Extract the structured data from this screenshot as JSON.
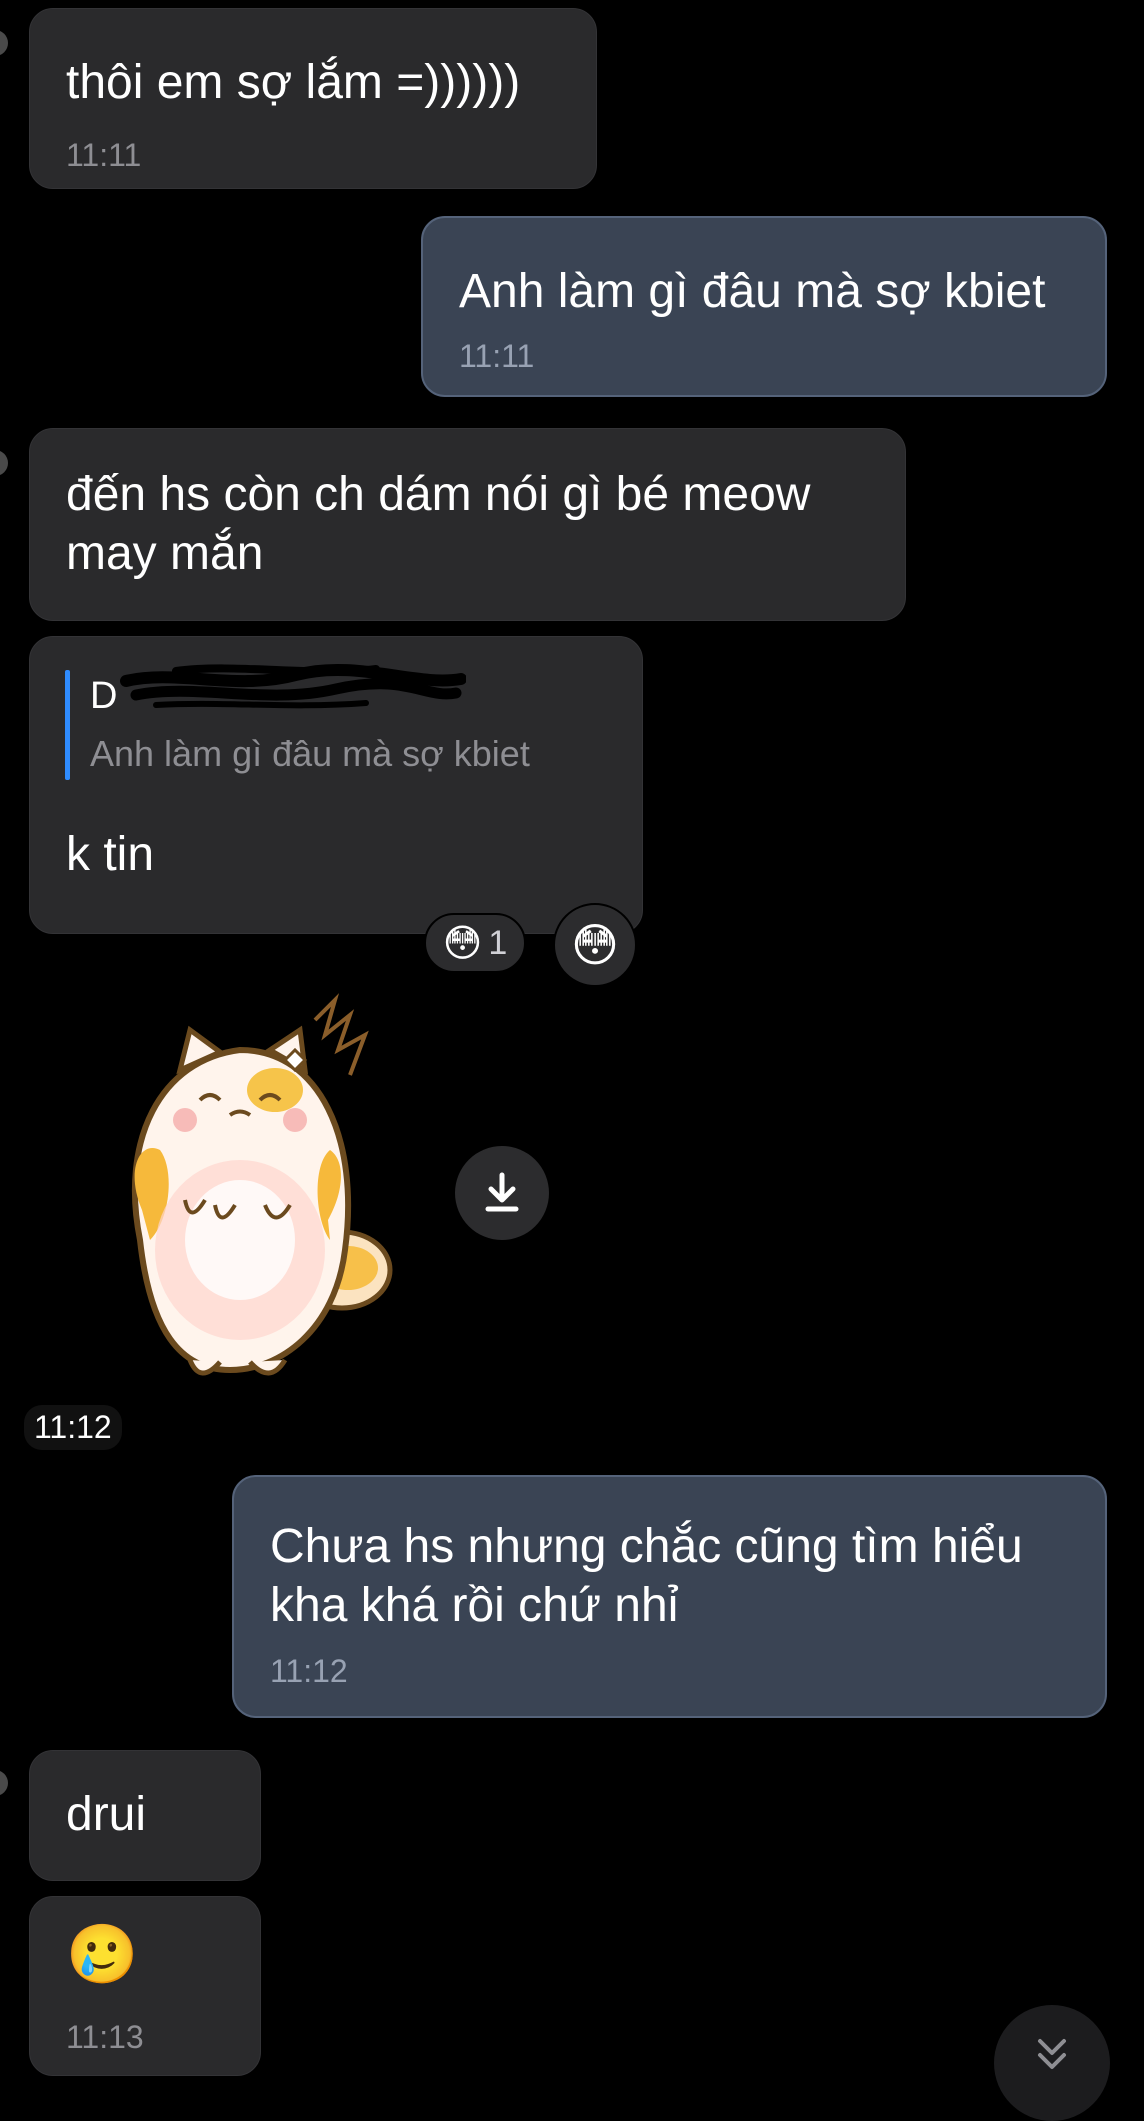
{
  "colors": {
    "background": "#000000",
    "incoming_bubble": "#2a2a2c",
    "outgoing_bubble": "#3a4454",
    "reply_accent": "#2f8cff",
    "timestamp": "#8e8e93"
  },
  "messages": [
    {
      "direction": "incoming",
      "text": "thôi em sợ lắm =))))))",
      "time": "11:11"
    },
    {
      "direction": "outgoing",
      "text": "Anh làm gì đâu mà sợ kbiet",
      "time": "11:11"
    },
    {
      "direction": "incoming",
      "lines": [
        "đến hs còn ch dám nói gì bé meow",
        "may mắn"
      ]
    },
    {
      "direction": "incoming",
      "reply": {
        "name": "D",
        "quote": "Anh làm gì đâu mà sợ kbiet"
      },
      "text": "k tin",
      "reactions": [
        {
          "emoji": "😳",
          "count": "1"
        },
        {
          "emoji": "😳"
        }
      ]
    },
    {
      "direction": "incoming",
      "type": "sticker",
      "sticker_icon": "sad-cat-sticker",
      "time": "11:12"
    },
    {
      "direction": "outgoing",
      "lines": [
        "Chưa hs nhưng chắc cũng tìm hiểu",
        "kha khá rồi chứ nhỉ"
      ],
      "time": "11:12"
    },
    {
      "direction": "incoming",
      "text": "drui"
    },
    {
      "direction": "incoming",
      "emoji": "🥲",
      "time": "11:13"
    }
  ],
  "controls": {
    "download_icon": "download-icon",
    "scroll_down_icon": "double-chevron-down-icon"
  }
}
